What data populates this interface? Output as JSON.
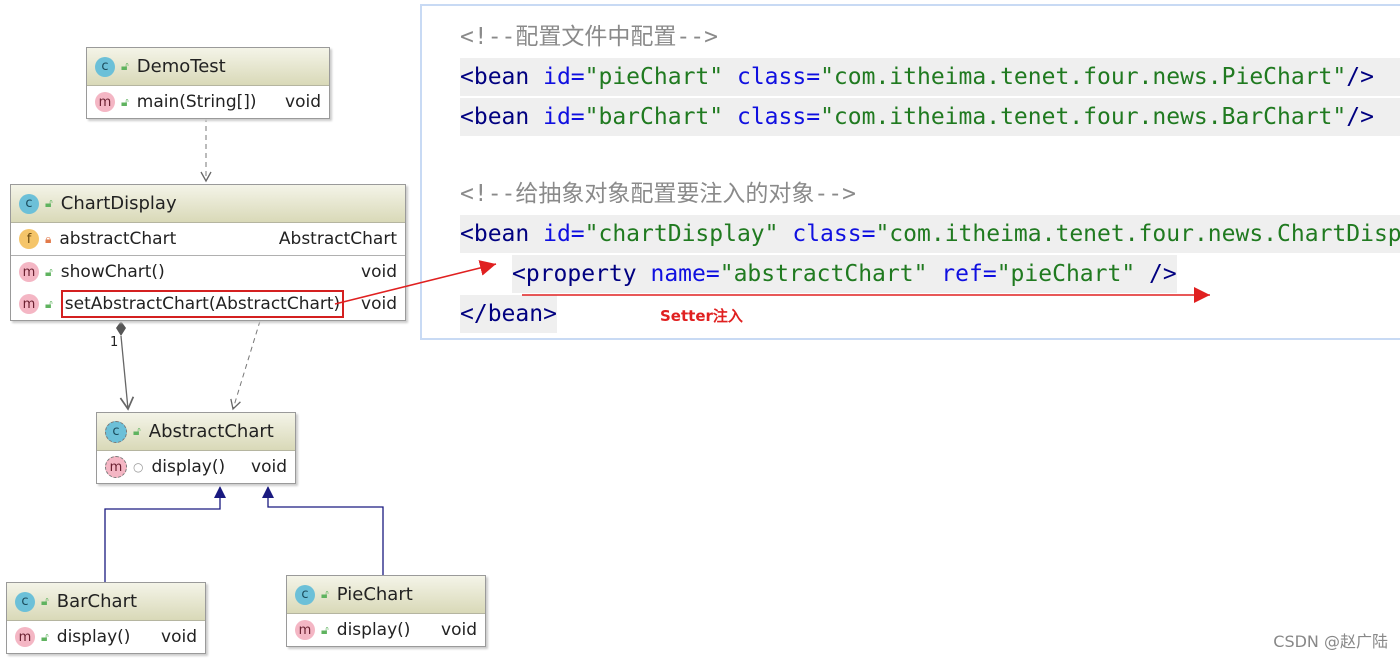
{
  "uml": {
    "classes": [
      {
        "id": "demotest",
        "name": "DemoTest",
        "icon": "class-runnable-icon",
        "members": [
          {
            "kind": "m",
            "name": "main(String[])",
            "type": "void"
          }
        ]
      },
      {
        "id": "chartdisplay",
        "name": "ChartDisplay",
        "icon": "class-icon",
        "fields": [
          {
            "kind": "f",
            "name": "abstractChart",
            "type": "AbstractChart"
          }
        ],
        "members": [
          {
            "kind": "m",
            "name": "showChart()",
            "type": "void"
          },
          {
            "kind": "m",
            "name": "setAbstractChart(AbstractChart)",
            "type": "void"
          }
        ]
      },
      {
        "id": "abstractchart",
        "name": "AbstractChart",
        "icon": "abstract-class-icon",
        "members": [
          {
            "kind": "m",
            "name": "display()",
            "type": "void"
          }
        ]
      },
      {
        "id": "barchart",
        "name": "BarChart",
        "icon": "class-icon",
        "members": [
          {
            "kind": "m",
            "name": "display()",
            "type": "void"
          }
        ]
      },
      {
        "id": "piechart",
        "name": "PieChart",
        "icon": "class-icon",
        "members": [
          {
            "kind": "m",
            "name": "display()",
            "type": "void"
          }
        ]
      }
    ],
    "multiplicity_top": "1",
    "multiplicity_comp": "1"
  },
  "code": {
    "comment1": "<!--配置文件中配置-->",
    "comment2": "<!--给抽象对象配置要注入的对象-->",
    "bean1": {
      "id": "\"pieChart\"",
      "cls": "\"com.itheima.tenet.four.news.PieChart\""
    },
    "bean2": {
      "id": "\"barChart\"",
      "cls": "\"com.itheima.tenet.four.news.BarChart\""
    },
    "bean3": {
      "id": "\"chartDisplay\"",
      "cls": "\"com.itheima.tenet.four.news.ChartDisplay\""
    },
    "property": {
      "name": "\"abstractChart\"",
      "ref": "\"pieChart\""
    },
    "t_bean": "<bean ",
    "t_id": "id=",
    "t_class": " class=",
    "t_close": "/>",
    "t_prop": "<property ",
    "t_name": "name=",
    "t_ref": " ref=",
    "t_pclose": " />",
    "t_end": "</bean>"
  },
  "annotation": {
    "label": "Setter注入",
    "color": "#e02020"
  },
  "watermark": "CSDN @赵广陆"
}
